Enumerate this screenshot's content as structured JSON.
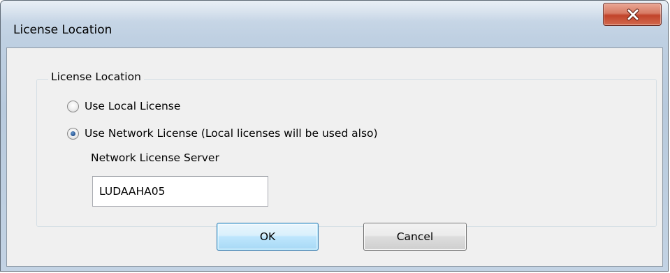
{
  "window": {
    "title": "License Location"
  },
  "group": {
    "legend": "License Location"
  },
  "options": [
    {
      "label": "Use Local License",
      "checked": false
    },
    {
      "label": "Use Network License (Local licenses will be used also)",
      "checked": true
    }
  ],
  "server": {
    "label": "Network License Server",
    "value": "LUDAAHA05"
  },
  "buttons": {
    "ok": "OK",
    "cancel": "Cancel"
  },
  "icons": {
    "close": "close-icon"
  }
}
